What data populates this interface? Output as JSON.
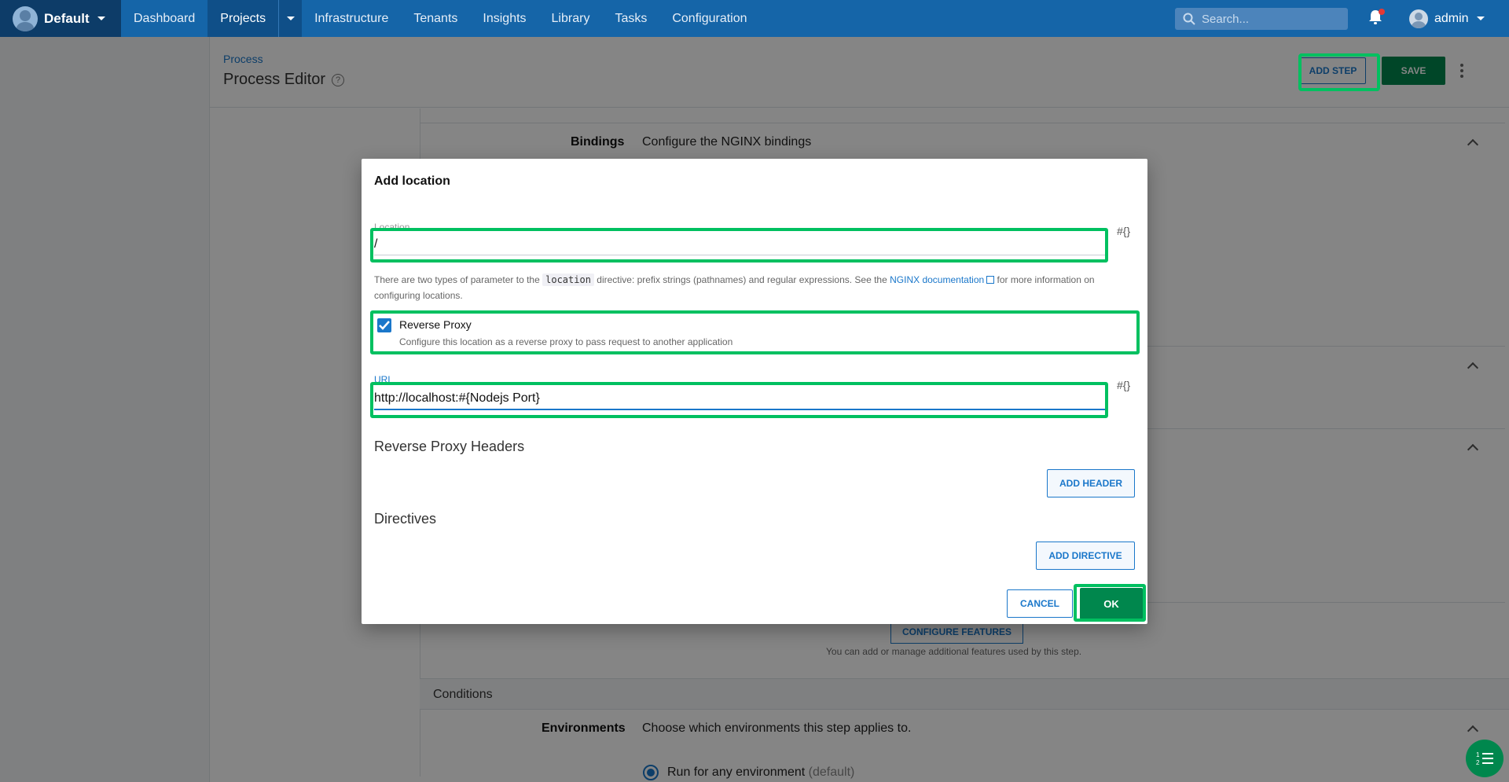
{
  "topbar": {
    "space_name": "Default",
    "nav": [
      "Dashboard",
      "Projects",
      "Infrastructure",
      "Tenants",
      "Insights",
      "Library",
      "Tasks",
      "Configuration"
    ],
    "search_placeholder": "Search...",
    "user": "admin"
  },
  "header": {
    "breadcrumb": "Process",
    "title": "Process Editor",
    "add_step": "ADD STEP",
    "save": "SAVE"
  },
  "background": {
    "bindings_label": "Bindings",
    "bindings_text": "Configure the NGINX bindings",
    "configure_features": "CONFIGURE FEATURES",
    "configure_note": "You can add or manage additional features used by this step.",
    "conditions": "Conditions",
    "environments_label": "Environments",
    "environments_text": "Choose which environments this step applies to.",
    "run_option": "Run for any environment",
    "run_option_default": "(default)"
  },
  "modal": {
    "title": "Add location",
    "location_label": "Location",
    "location_value": "/",
    "var_icon": "#{}",
    "help_pre": "There are two types of parameter to the",
    "help_code": "location",
    "help_mid": "directive: prefix strings (pathnames) and regular expressions. See the",
    "help_link": "NGINX documentation",
    "help_post": "for more information on configuring locations.",
    "reverse_proxy_label": "Reverse Proxy",
    "reverse_proxy_note": "Configure this location as a reverse proxy to pass request to another application",
    "url_label": "URL",
    "url_value": "http://localhost:#{Nodejs Port}",
    "headers_title": "Reverse Proxy Headers",
    "add_header": "ADD HEADER",
    "directives_title": "Directives",
    "add_directive": "ADD DIRECTIVE",
    "cancel": "CANCEL",
    "ok": "OK"
  },
  "colors": {
    "brand": "#1565a8",
    "accent": "#1a77ca",
    "primary_action": "#00874d",
    "highlight": "#00c060"
  }
}
